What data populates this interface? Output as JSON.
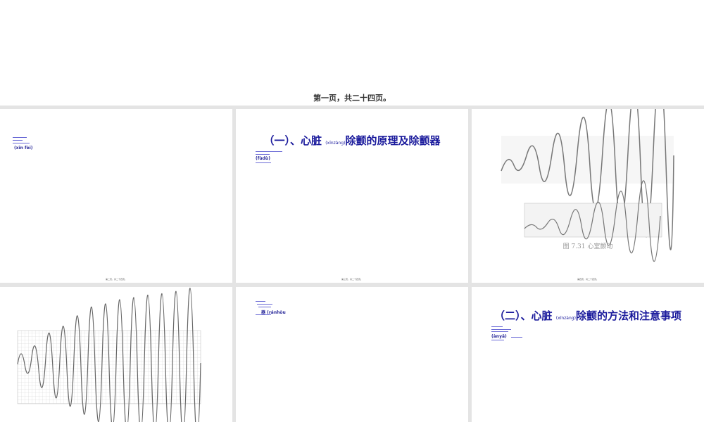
{
  "header": {
    "page_counter": "第一页，共二十四页。"
  },
  "slides": [
    {
      "inline": "(xīn fèi)",
      "footer": "第二页，共二十四页。"
    },
    {
      "title": "（一）、心脏",
      "title_pinyin": "(xīnzàng)",
      "title_rest": "除颤的原理及除颤器",
      "inline": "(fùdù)",
      "footer": "第三页，共二十四页。"
    },
    {
      "figure_caption": "图 7.31  心室颤动",
      "footer": "第四页，共二十四页。"
    },
    {},
    {
      "inline": "器 (ránhòu"
    },
    {
      "title": "（二）、心脏",
      "title_pinyin": "(xīnzàng)",
      "title_rest": "除颤的方法和注意事项",
      "inline": "(ànyā)"
    }
  ]
}
